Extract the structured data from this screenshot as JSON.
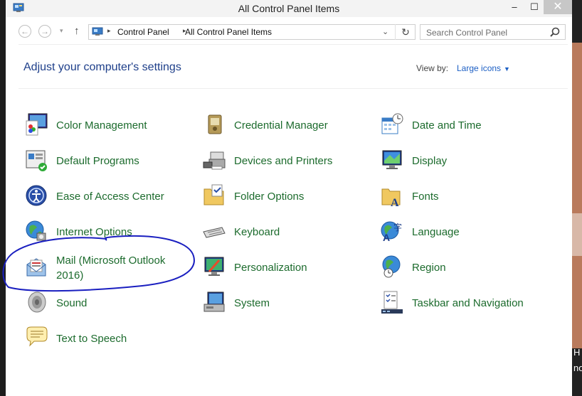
{
  "window": {
    "title": "All Control Panel Items",
    "buttons": {
      "minimize": "–",
      "maximize": "☐",
      "close": "✕"
    }
  },
  "nav": {
    "back": "←",
    "forward": "→",
    "dropdown": "▾",
    "up": "↑",
    "breadcrumbs": [
      "Control Panel",
      "All Control Panel Items"
    ],
    "breadcrumb_separator": "▸",
    "address_dropdown": "⌄",
    "refresh": "↻"
  },
  "search": {
    "placeholder": "Search Control Panel",
    "icon": "magnifier-icon"
  },
  "header": {
    "title": "Adjust your computer's settings",
    "view_by_label": "View by:",
    "view_by_value": "Large icons",
    "view_by_caret": "▼"
  },
  "items": [
    {
      "label": "Color Management",
      "icon": "color-management-icon"
    },
    {
      "label": "Credential Manager",
      "icon": "credential-manager-icon"
    },
    {
      "label": "Date and Time",
      "icon": "date-time-icon"
    },
    {
      "label": "Default Programs",
      "icon": "default-programs-icon"
    },
    {
      "label": "Devices and Printers",
      "icon": "devices-printers-icon"
    },
    {
      "label": "Display",
      "icon": "display-icon"
    },
    {
      "label": "Ease of Access Center",
      "icon": "ease-of-access-icon"
    },
    {
      "label": "Folder Options",
      "icon": "folder-options-icon"
    },
    {
      "label": "Fonts",
      "icon": "fonts-icon"
    },
    {
      "label": "Internet Options",
      "icon": "internet-options-icon"
    },
    {
      "label": "Keyboard",
      "icon": "keyboard-icon"
    },
    {
      "label": "Language",
      "icon": "language-icon"
    },
    {
      "label": "Mail (Microsoft Outlook 2016)",
      "icon": "mail-icon"
    },
    {
      "label": "Personalization",
      "icon": "personalization-icon"
    },
    {
      "label": "Region",
      "icon": "region-icon"
    },
    {
      "label": "Sound",
      "icon": "sound-icon"
    },
    {
      "label": "System",
      "icon": "system-icon"
    },
    {
      "label": "Taskbar and Navigation",
      "icon": "taskbar-navigation-icon"
    },
    {
      "label": "Text to Speech",
      "icon": "text-to-speech-icon"
    }
  ],
  "colors": {
    "link_green": "#1c6b2d",
    "heading_blue": "#1e3f8a",
    "annotation_blue": "#1a1fc0"
  },
  "background": {
    "edge_text": "H\nno"
  }
}
